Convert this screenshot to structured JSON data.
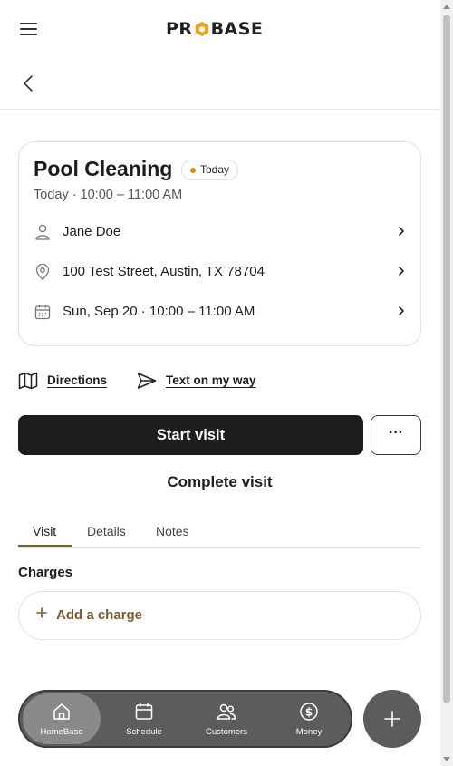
{
  "header": {
    "logo_text_left": "PR",
    "logo_text_right": "BASE"
  },
  "visit": {
    "title": "Pool Cleaning",
    "badge": "Today",
    "subtitle": "Today · 10:00 – 11:00 AM",
    "customer": "Jane Doe",
    "address": "100 Test Street, Austin, TX 78704",
    "schedule": "Sun, Sep 20 · 10:00 – 11:00 AM"
  },
  "links": {
    "directions": "Directions",
    "text_on_my_way": "Text on my way"
  },
  "actions": {
    "start": "Start visit",
    "more": "···",
    "complete": "Complete visit"
  },
  "tabs": [
    {
      "label": "Visit"
    },
    {
      "label": "Details"
    },
    {
      "label": "Notes"
    }
  ],
  "charges": {
    "title": "Charges",
    "add_label": "Add a charge"
  },
  "nav": {
    "items": [
      {
        "label": "HomeBase",
        "icon": "home-icon"
      },
      {
        "label": "Schedule",
        "icon": "calendar-icon"
      },
      {
        "label": "Customers",
        "icon": "users-icon"
      },
      {
        "label": "Money",
        "icon": "dollar-icon"
      }
    ]
  },
  "colors": {
    "accent": "#7a5c2e",
    "badge_dot": "#d08b2c",
    "primary_button": "#1e1e1e",
    "nav_bg": "#5c5c5c"
  }
}
